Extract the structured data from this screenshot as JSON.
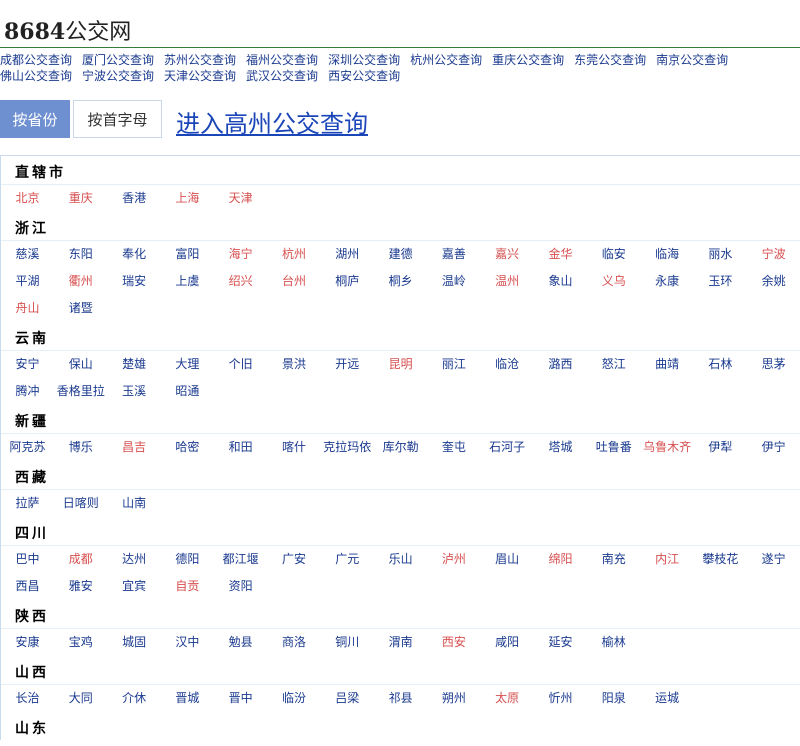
{
  "logo": {
    "num": "8684",
    "cn": "公交网"
  },
  "nav_cities": [
    "成都公交查询",
    "厦门公交查询",
    "苏州公交查询",
    "福州公交查询",
    "深圳公交查询",
    "杭州公交查询",
    "重庆公交查询",
    "东莞公交查询",
    "南京公交查询",
    "佛山公交查询",
    "宁波公交查询",
    "天津公交查询",
    "武汉公交查询",
    "西安公交查询"
  ],
  "tabs": {
    "by_province": "按省份",
    "by_initial": "按首字母"
  },
  "enter_link": "进入高州公交查询",
  "colors": {
    "link": "#1a3a8f",
    "hot": "#d75050",
    "tab_active": "#6e8fd0"
  },
  "provinces": [
    {
      "name": "直辖市",
      "rows": [
        [
          {
            "n": "北京",
            "hot": true
          },
          {
            "n": "重庆",
            "hot": true
          },
          {
            "n": "香港",
            "hot": false
          },
          {
            "n": "上海",
            "hot": true
          },
          {
            "n": "天津",
            "hot": true
          }
        ]
      ]
    },
    {
      "name": "浙江",
      "rows": [
        [
          {
            "n": "慈溪",
            "hot": false
          },
          {
            "n": "东阳",
            "hot": false
          },
          {
            "n": "奉化",
            "hot": false
          },
          {
            "n": "富阳",
            "hot": false
          },
          {
            "n": "海宁",
            "hot": true
          },
          {
            "n": "杭州",
            "hot": true
          },
          {
            "n": "湖州",
            "hot": false
          },
          {
            "n": "建德",
            "hot": false
          },
          {
            "n": "嘉善",
            "hot": false
          },
          {
            "n": "嘉兴",
            "hot": true
          },
          {
            "n": "金华",
            "hot": true
          },
          {
            "n": "临安",
            "hot": false
          },
          {
            "n": "临海",
            "hot": false
          },
          {
            "n": "丽水",
            "hot": false
          },
          {
            "n": "宁波",
            "hot": true
          }
        ],
        [
          {
            "n": "平湖",
            "hot": false
          },
          {
            "n": "衢州",
            "hot": true
          },
          {
            "n": "瑞安",
            "hot": false
          },
          {
            "n": "上虞",
            "hot": false
          },
          {
            "n": "绍兴",
            "hot": true
          },
          {
            "n": "台州",
            "hot": true
          },
          {
            "n": "桐庐",
            "hot": false
          },
          {
            "n": "桐乡",
            "hot": false
          },
          {
            "n": "温岭",
            "hot": false
          },
          {
            "n": "温州",
            "hot": true
          },
          {
            "n": "象山",
            "hot": false
          },
          {
            "n": "义乌",
            "hot": true
          },
          {
            "n": "永康",
            "hot": false
          },
          {
            "n": "玉环",
            "hot": false
          },
          {
            "n": "余姚",
            "hot": false
          }
        ],
        [
          {
            "n": "舟山",
            "hot": true
          },
          {
            "n": "诸暨",
            "hot": false
          }
        ]
      ]
    },
    {
      "name": "云南",
      "rows": [
        [
          {
            "n": "安宁",
            "hot": false
          },
          {
            "n": "保山",
            "hot": false
          },
          {
            "n": "楚雄",
            "hot": false
          },
          {
            "n": "大理",
            "hot": false
          },
          {
            "n": "个旧",
            "hot": false
          },
          {
            "n": "景洪",
            "hot": false
          },
          {
            "n": "开远",
            "hot": false
          },
          {
            "n": "昆明",
            "hot": true
          },
          {
            "n": "丽江",
            "hot": false
          },
          {
            "n": "临沧",
            "hot": false
          },
          {
            "n": "潞西",
            "hot": false
          },
          {
            "n": "怒江",
            "hot": false
          },
          {
            "n": "曲靖",
            "hot": false
          },
          {
            "n": "石林",
            "hot": false
          },
          {
            "n": "思茅",
            "hot": false
          }
        ],
        [
          {
            "n": "腾冲",
            "hot": false
          },
          {
            "n": "香格里拉",
            "hot": false
          },
          {
            "n": "玉溪",
            "hot": false
          },
          {
            "n": "昭通",
            "hot": false
          }
        ]
      ]
    },
    {
      "name": "新疆",
      "rows": [
        [
          {
            "n": "阿克苏",
            "hot": false
          },
          {
            "n": "博乐",
            "hot": false
          },
          {
            "n": "昌吉",
            "hot": true
          },
          {
            "n": "哈密",
            "hot": false
          },
          {
            "n": "和田",
            "hot": false
          },
          {
            "n": "喀什",
            "hot": false
          },
          {
            "n": "克拉玛依",
            "hot": false
          },
          {
            "n": "库尔勒",
            "hot": false
          },
          {
            "n": "奎屯",
            "hot": false
          },
          {
            "n": "石河子",
            "hot": false
          },
          {
            "n": "塔城",
            "hot": false
          },
          {
            "n": "吐鲁番",
            "hot": false
          },
          {
            "n": "乌鲁木齐",
            "hot": true
          },
          {
            "n": "伊犁",
            "hot": false
          },
          {
            "n": "伊宁",
            "hot": false
          }
        ]
      ]
    },
    {
      "name": "西藏",
      "rows": [
        [
          {
            "n": "拉萨",
            "hot": false
          },
          {
            "n": "日喀则",
            "hot": false
          },
          {
            "n": "山南",
            "hot": false
          }
        ]
      ]
    },
    {
      "name": "四川",
      "rows": [
        [
          {
            "n": "巴中",
            "hot": false
          },
          {
            "n": "成都",
            "hot": true
          },
          {
            "n": "达州",
            "hot": false
          },
          {
            "n": "德阳",
            "hot": false
          },
          {
            "n": "都江堰",
            "hot": false
          },
          {
            "n": "广安",
            "hot": false
          },
          {
            "n": "广元",
            "hot": false
          },
          {
            "n": "乐山",
            "hot": false
          },
          {
            "n": "泸州",
            "hot": true
          },
          {
            "n": "眉山",
            "hot": false
          },
          {
            "n": "绵阳",
            "hot": true
          },
          {
            "n": "南充",
            "hot": false
          },
          {
            "n": "内江",
            "hot": true
          },
          {
            "n": "攀枝花",
            "hot": false
          },
          {
            "n": "遂宁",
            "hot": false
          }
        ],
        [
          {
            "n": "西昌",
            "hot": false
          },
          {
            "n": "雅安",
            "hot": false
          },
          {
            "n": "宜宾",
            "hot": false
          },
          {
            "n": "自贡",
            "hot": true
          },
          {
            "n": "资阳",
            "hot": false
          }
        ]
      ]
    },
    {
      "name": "陕西",
      "rows": [
        [
          {
            "n": "安康",
            "hot": false
          },
          {
            "n": "宝鸡",
            "hot": false
          },
          {
            "n": "城固",
            "hot": false
          },
          {
            "n": "汉中",
            "hot": false
          },
          {
            "n": "勉县",
            "hot": false
          },
          {
            "n": "商洛",
            "hot": false
          },
          {
            "n": "铜川",
            "hot": false
          },
          {
            "n": "渭南",
            "hot": false
          },
          {
            "n": "西安",
            "hot": true
          },
          {
            "n": "咸阳",
            "hot": false
          },
          {
            "n": "延安",
            "hot": false
          },
          {
            "n": "榆林",
            "hot": false
          }
        ]
      ]
    },
    {
      "name": "山西",
      "rows": [
        [
          {
            "n": "长治",
            "hot": false
          },
          {
            "n": "大同",
            "hot": false
          },
          {
            "n": "介休",
            "hot": false
          },
          {
            "n": "晋城",
            "hot": false
          },
          {
            "n": "晋中",
            "hot": false
          },
          {
            "n": "临汾",
            "hot": false
          },
          {
            "n": "吕梁",
            "hot": false
          },
          {
            "n": "祁县",
            "hot": false
          },
          {
            "n": "朔州",
            "hot": false
          },
          {
            "n": "太原",
            "hot": true
          },
          {
            "n": "忻州",
            "hot": false
          },
          {
            "n": "阳泉",
            "hot": false
          },
          {
            "n": "运城",
            "hot": false
          }
        ]
      ]
    },
    {
      "name": "山东",
      "rows": []
    }
  ]
}
